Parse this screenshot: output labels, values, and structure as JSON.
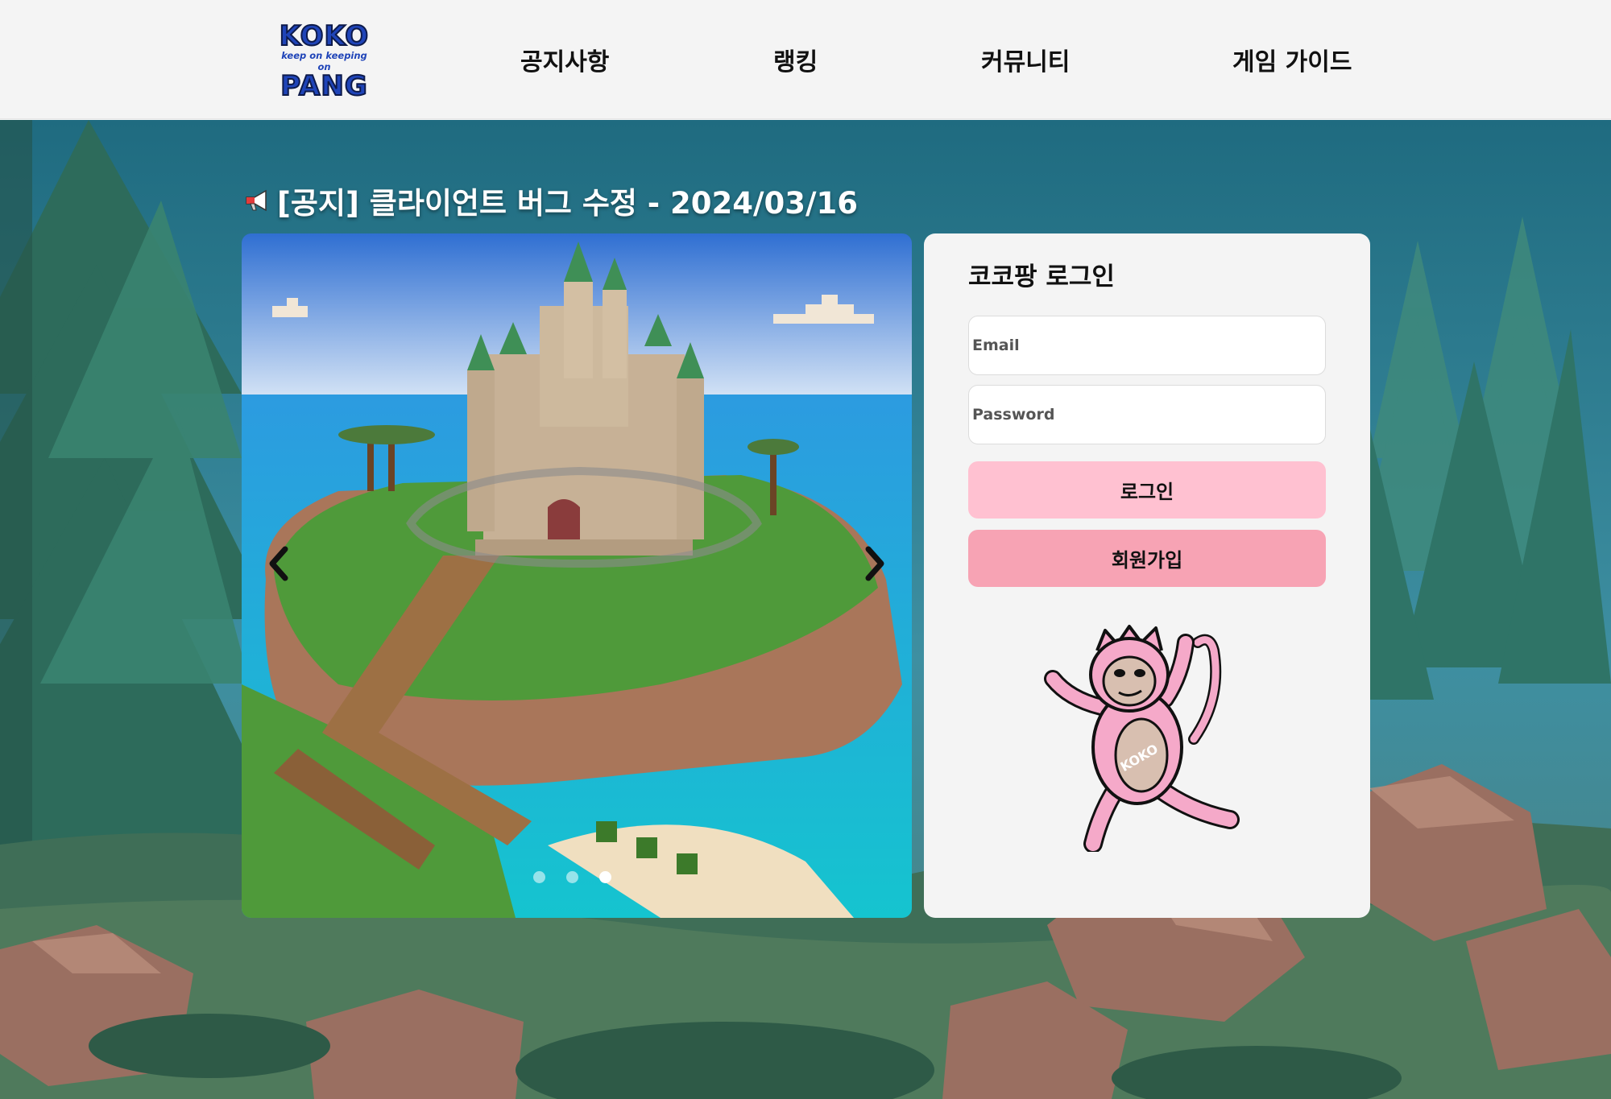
{
  "header": {
    "logo": {
      "line1": "KOKO",
      "line2": "keep on keeping on",
      "line3": "PANG"
    },
    "nav": [
      {
        "label": "공지사항"
      },
      {
        "label": "랭킹"
      },
      {
        "label": "커뮤니티"
      },
      {
        "label": "게임 가이드"
      }
    ]
  },
  "notice": {
    "icon": "megaphone-icon",
    "text": "[공지] 클라이언트 버그 수정 - 2024/03/16"
  },
  "carousel": {
    "slide_count": 3,
    "active_slide": 3,
    "prev_icon": "chevron-left-icon",
    "next_icon": "chevron-right-icon"
  },
  "login": {
    "title": "코코팡 로그인",
    "email_placeholder": "Email",
    "password_placeholder": "Password",
    "login_label": "로그인",
    "signup_label": "회원가입",
    "mascot": {
      "badge_text": "KOKO"
    }
  },
  "colors": {
    "header_bg": "#f4f4f4",
    "logo_blue": "#1f44b8",
    "login_button": "#ffc1d1",
    "signup_button": "#f7a3b4",
    "mascot_pink": "#f5a9c9"
  }
}
